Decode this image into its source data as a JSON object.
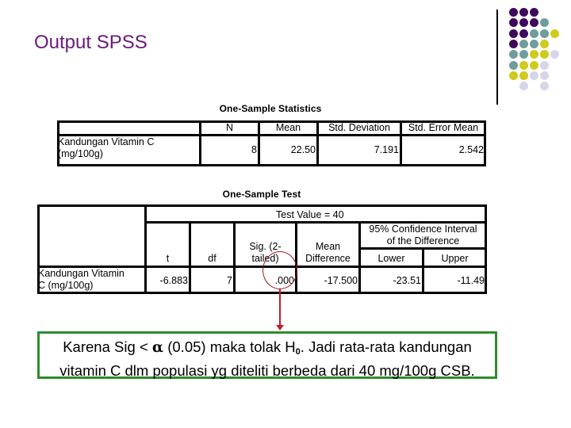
{
  "slide": {
    "title": "Output SPSS",
    "theme_dot_colors": {
      "purple": "#3e0a5c",
      "teal": "#6f9c9c",
      "yellow": "#cfca1c",
      "lavender": "#d6d6e8"
    },
    "title_color": "#6a1a78"
  },
  "stats_table": {
    "title": "One-Sample Statistics",
    "headers": [
      "",
      "N",
      "Mean",
      "Std. Deviation",
      "Std. Error Mean"
    ],
    "rows": [
      {
        "label_line1": "Kandungan Vitamin C",
        "label_line2": "(mg/100g)",
        "n": "8",
        "mean": "22.50",
        "std_deviation": "7.191",
        "std_error_mean": "2.542"
      }
    ]
  },
  "test_table": {
    "title": "One-Sample Test",
    "test_value_label": "Test Value = 40",
    "headers": {
      "t": "t",
      "df": "df",
      "sig_line1": "Sig. (2-",
      "sig_line2": "tailed)",
      "mean_diff_line1": "Mean",
      "mean_diff_line2": "Difference",
      "ci_line1": "95% Confidence Interval",
      "ci_line2": "of the Difference",
      "lower": "Lower",
      "upper": "Upper"
    },
    "rows": [
      {
        "label_line1": "Kandungan Vitamin",
        "label_line2": "C (mg/100g)",
        "t": "-6.883",
        "df": "7",
        "sig": ".000",
        "mean_difference": "-17.500",
        "lower": "-23.51",
        "upper": "-11.49"
      }
    ]
  },
  "annotation": {
    "circle_color": "#9b1c24",
    "arrow_color": "#c0202a",
    "box_border_color": "#2e8b2e",
    "line1_pre": "Karena Sig < ",
    "alpha_symbol": "α",
    "line1_mid": " (0.05) maka tolak H",
    "h_subscript": "0",
    "line1_post": ".  Jadi rata-rata kandungan",
    "line2": "vitamin C dlm populasi yg diteliti berbeda dari 40 mg/100g CSB."
  }
}
